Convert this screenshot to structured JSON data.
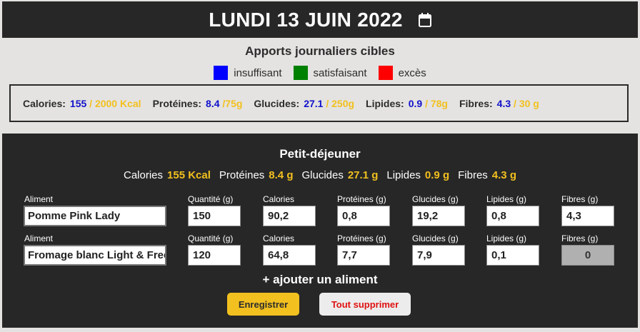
{
  "header": {
    "date": "LUNDI 13 JUIN 2022",
    "calendar_icon": "calendar-icon"
  },
  "targets": {
    "title": "Apports journaliers cibles",
    "legend": [
      {
        "label": "insuffisant",
        "color": "#0000ff"
      },
      {
        "label": "satisfaisant",
        "color": "#008000"
      },
      {
        "label": "excès",
        "color": "#ff0000"
      }
    ],
    "items": [
      {
        "label": "Calories:",
        "current": "155",
        "target": " / 2000 Kcal"
      },
      {
        "label": "Protéines:",
        "current": "8.4",
        "target": " /75g"
      },
      {
        "label": "Glucides:",
        "current": "27.1",
        "target": " / 250g"
      },
      {
        "label": "Lipides:",
        "current": "0.9",
        "target": " / 78g"
      },
      {
        "label": "Fibres:",
        "current": "4.3",
        "target": " / 30 g"
      }
    ]
  },
  "meal": {
    "title": "Petit-déjeuner",
    "totals": [
      {
        "label": "Calories",
        "value": "155 Kcal"
      },
      {
        "label": "Protéines",
        "value": "8.4 g"
      },
      {
        "label": "Glucides",
        "value": "27.1 g"
      },
      {
        "label": "Lipides",
        "value": "0.9 g"
      },
      {
        "label": "Fibres",
        "value": "4.3 g"
      }
    ],
    "columns": [
      "Aliment",
      "Quantité (g)",
      "Calories",
      "Protéines (g)",
      "Glucides (g)",
      "Lipides (g)",
      "Fibres (g)"
    ],
    "rows": [
      {
        "aliment": "Pomme Pink Lady",
        "quantite": "150",
        "calories": "90,2",
        "proteines": "0,8",
        "glucides": "19,2",
        "lipides": "0,8",
        "fibres": "4,3"
      },
      {
        "aliment": "Fromage blanc Light & Free",
        "quantite": "120",
        "calories": "64,8",
        "proteines": "7,7",
        "glucides": "7,9",
        "lipides": "0,1",
        "fibres": "0"
      }
    ],
    "add_label": "+ ajouter un aliment",
    "save_label": "Enregistrer",
    "clear_label": "Tout supprimer"
  },
  "colors": {
    "accent": "#f2c01f",
    "dark": "#272727",
    "current": "#1111cc",
    "danger": "#e01010"
  }
}
